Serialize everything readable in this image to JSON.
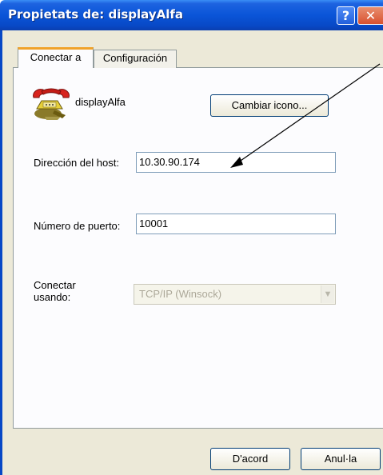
{
  "window": {
    "title": "Propietats de: displayAlfa",
    "help_glyph": "?",
    "close_glyph": "✕"
  },
  "tabs": [
    {
      "label": "Conectar a",
      "active": true
    },
    {
      "label": "Configuración",
      "active": false
    }
  ],
  "connection": {
    "icon": "telephone-icon",
    "name": "displayAlfa",
    "change_icon_button": "Cambiar icono..."
  },
  "fields": {
    "host_label": "Dirección del host:",
    "host_value": "10.30.90.174",
    "port_label": "Número de puerto:",
    "port_value": "10001",
    "connect_using_label_line1": "Conectar",
    "connect_using_label_line2": "usando:",
    "connect_using_value": "TCP/IP (Winsock)"
  },
  "buttons": {
    "ok": "D'acord",
    "cancel": "Anul·la"
  },
  "colors": {
    "titlebar": "#0a55d8",
    "tab_highlight": "#f0a22a",
    "disabled_text": "#aca899"
  }
}
